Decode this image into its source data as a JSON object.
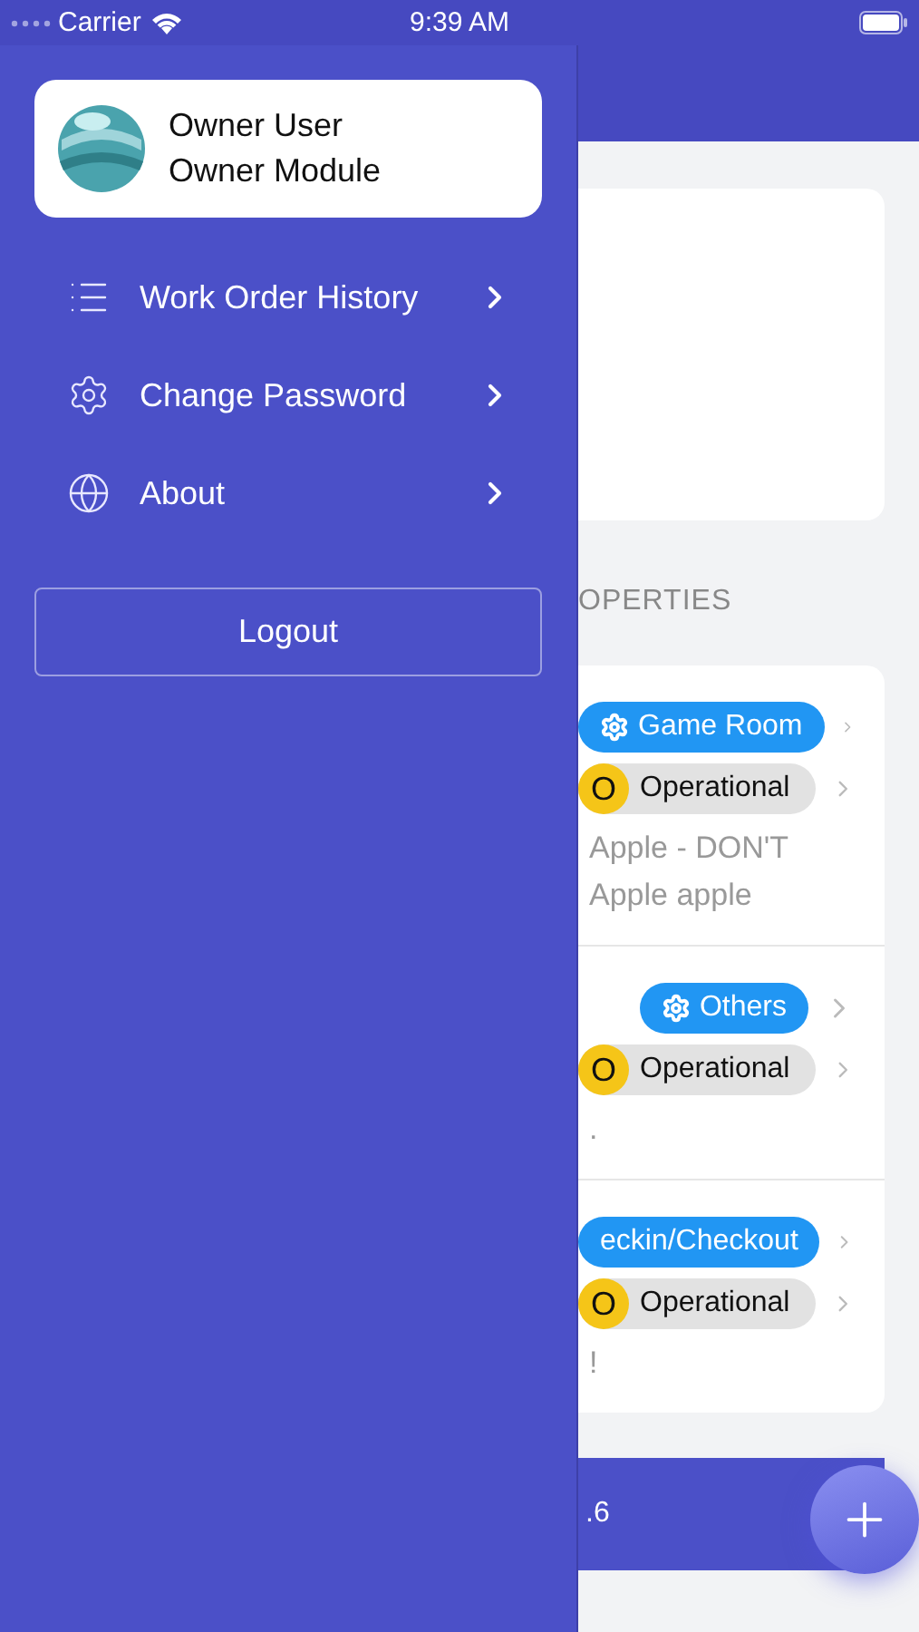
{
  "status_bar": {
    "carrier": "Carrier",
    "time": "9:39 AM"
  },
  "drawer": {
    "user": {
      "name": "Owner User",
      "module": "Owner Module"
    },
    "items": [
      {
        "label": "Work Order History"
      },
      {
        "label": "Change Password"
      },
      {
        "label": "About"
      }
    ],
    "logout": "Logout"
  },
  "background": {
    "section_heading": "OPERTIES",
    "rows": [
      {
        "category": "Game Room",
        "category_icon": true,
        "status_letter": "O",
        "status": "Operational",
        "lines": [
          "Apple - DON'T",
          "Apple apple"
        ]
      },
      {
        "category": "Others",
        "category_icon": true,
        "status_letter": "O",
        "status": "Operational",
        "lines": [
          "."
        ]
      },
      {
        "category": "eckin/Checkout",
        "category_icon": false,
        "status_letter": "O",
        "status": "Operational",
        "lines": [
          "!"
        ]
      }
    ],
    "footer": ".6"
  }
}
